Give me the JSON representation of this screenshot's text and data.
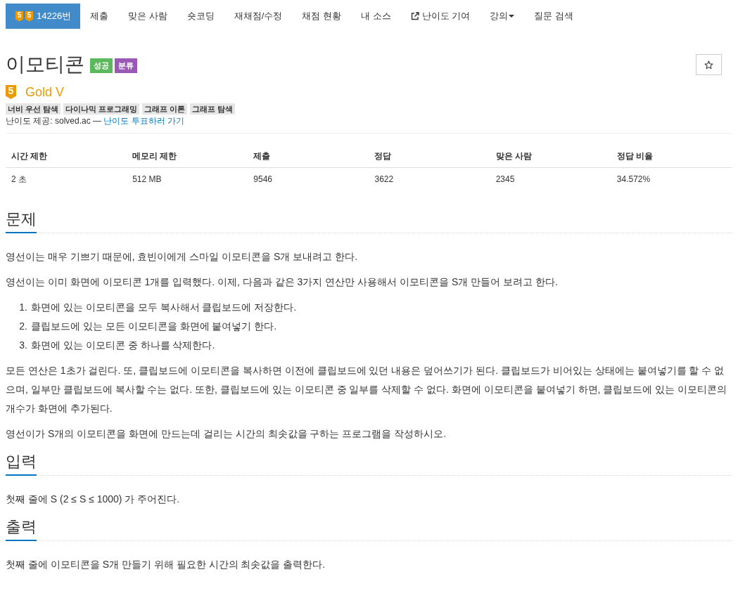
{
  "navbar": {
    "items": [
      {
        "kind": "problem",
        "badges": [
          "5",
          "5"
        ],
        "label": "14226번",
        "selected": true
      },
      {
        "kind": "link",
        "label": "제출",
        "selected": false
      },
      {
        "kind": "link",
        "label": "맞은 사람",
        "selected": false
      },
      {
        "kind": "link",
        "label": "숏코딩",
        "selected": false
      },
      {
        "kind": "link",
        "label": "재채점/수정",
        "selected": false
      },
      {
        "kind": "link",
        "label": "채점 현황",
        "selected": false
      },
      {
        "kind": "link",
        "label": "내 소스",
        "selected": false
      },
      {
        "kind": "external",
        "label": "난이도 기여",
        "selected": false
      },
      {
        "kind": "dropdown",
        "label": "강의",
        "selected": false
      },
      {
        "kind": "link",
        "label": "질문 검색",
        "selected": false
      }
    ]
  },
  "problem": {
    "title": "이모티콘",
    "labels": [
      {
        "text": "성공",
        "color": "#5cb85c"
      },
      {
        "text": "분류",
        "color": "#9b59b6"
      }
    ],
    "starred": false,
    "tier": {
      "badge": "5",
      "name": "Gold V"
    },
    "tags": [
      "너비 우선 탐색",
      "다이나믹 프로그래밍",
      "그래프 이론",
      "그래프 탐색"
    ],
    "source": {
      "text": "난이도 제공: solved.ac —",
      "link": "난이도 투표하러 가기"
    }
  },
  "info_table": {
    "columns": [
      "시간 제한",
      "메모리 제한",
      "제출",
      "정답",
      "맞은 사람",
      "정답 비율"
    ],
    "rows": [
      [
        "2 초",
        "512 MB",
        "9546",
        "3622",
        "2345",
        "34.572%"
      ]
    ]
  },
  "sections": [
    {
      "heading": "문제",
      "blocks": [
        {
          "kind": "paragraph",
          "text": "영선이는 매우 기쁘기 때문에, 효빈이에게 스마일 이모티콘을 S개 보내려고 한다."
        },
        {
          "kind": "paragraph",
          "text": "영선이는 이미 화면에 이모티콘 1개를 입력했다. 이제, 다음과 같은 3가지 연산만 사용해서 이모티콘을 S개 만들어 보려고 한다."
        },
        {
          "kind": "list",
          "items": [
            {
              "marker": "1.",
              "text": "화면에 있는 이모티콘을 모두 복사해서 클립보드에 저장한다."
            },
            {
              "marker": "2.",
              "text": "클립보드에 있는 모든 이모티콘을 화면에 붙여넣기 한다."
            },
            {
              "marker": "3.",
              "text": "화면에 있는 이모티콘 중 하나를 삭제한다."
            }
          ]
        },
        {
          "kind": "paragraph",
          "text": "모든 연산은 1초가 걸린다. 또, 클립보드에 이모티콘을 복사하면 이전에 클립보드에 있던 내용은 덮어쓰기가 된다. 클립보드가 비어있는 상태에는 붙여넣기를 할 수 없으며, 일부만 클립보드에 복사할 수는 없다. 또한, 클립보드에 있는 이모티콘 중 일부를 삭제할 수 없다. 화면에 이모티콘을 붙여넣기 하면, 클립보드에 있는 이모티콘의 개수가 화면에 추가된다."
        },
        {
          "kind": "paragraph",
          "text": "영선이가 S개의 이모티콘을 화면에 만드는데 걸리는 시간의 최솟값을 구하는 프로그램을 작성하시오."
        }
      ]
    },
    {
      "heading": "입력",
      "blocks": [
        {
          "kind": "paragraph",
          "text": "첫째 줄에 S (2 ≤ S ≤ 1000) 가 주어진다."
        }
      ]
    },
    {
      "heading": "출력",
      "blocks": [
        {
          "kind": "paragraph",
          "text": "첫째 줄에 이모티콘을 S개 만들기 위해 필요한 시간의 최솟값을 출력한다."
        }
      ]
    }
  ]
}
